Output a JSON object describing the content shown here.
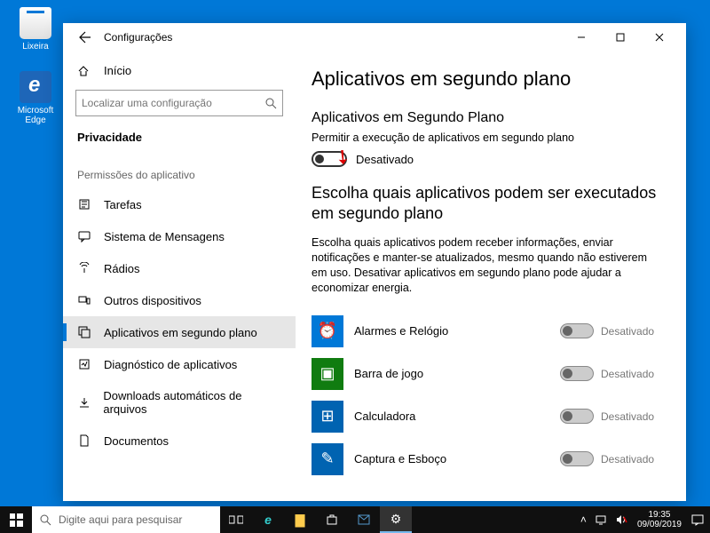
{
  "desktop": {
    "recycle_bin": "Lixeira",
    "edge": "Microsoft Edge"
  },
  "window": {
    "title": "Configurações"
  },
  "sidebar": {
    "home": "Início",
    "search_placeholder": "Localizar uma configuração",
    "category": "Privacidade",
    "permissions_header": "Permissões do aplicativo",
    "items": [
      {
        "label": "Tarefas"
      },
      {
        "label": "Sistema de Mensagens"
      },
      {
        "label": "Rádios"
      },
      {
        "label": "Outros dispositivos"
      },
      {
        "label": "Aplicativos em segundo plano"
      },
      {
        "label": "Diagnóstico de aplicativos"
      },
      {
        "label": "Downloads automáticos de arquivos"
      },
      {
        "label": "Documentos"
      }
    ]
  },
  "main": {
    "heading": "Aplicativos em segundo plano",
    "subheading": "Aplicativos em Segundo Plano",
    "allow_label": "Permitir a execução de aplicativos em segundo plano",
    "toggle_state": "Desativado",
    "choose_heading": "Escolha quais aplicativos podem ser executados em segundo plano",
    "choose_desc": "Escolha quais aplicativos podem receber informações, enviar notificações e manter-se atualizados, mesmo quando não estiverem em uso. Desativar aplicativos em segundo plano pode ajudar a economizar energia.",
    "apps": [
      {
        "name": "Alarmes e Relógio",
        "color": "#0078d7",
        "glyph": "⏰",
        "state": "Desativado"
      },
      {
        "name": "Barra de jogo",
        "color": "#107c10",
        "glyph": "▣",
        "state": "Desativado"
      },
      {
        "name": "Calculadora",
        "color": "#0063b1",
        "glyph": "⊞",
        "state": "Desativado"
      },
      {
        "name": "Captura e Esboço",
        "color": "#0063b1",
        "glyph": "✎",
        "state": "Desativado"
      }
    ]
  },
  "taskbar": {
    "search_placeholder": "Digite aqui para pesquisar",
    "time": "19:35",
    "date": "09/09/2019"
  }
}
